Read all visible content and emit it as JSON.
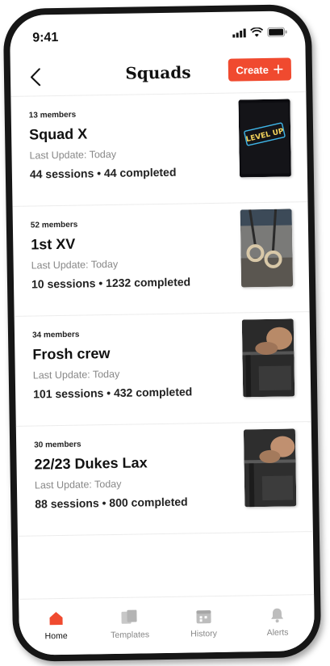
{
  "status_bar": {
    "time": "9:41"
  },
  "header": {
    "title": "Squads",
    "create_label": "Create"
  },
  "squads": [
    {
      "members": "13 members",
      "name": "Squad X",
      "last_update": "Last Update: Today",
      "stats": "44 sessions • 44 completed"
    },
    {
      "members": "52 members",
      "name": "1st XV",
      "last_update": "Last Update: Today",
      "stats": "10 sessions • 1232 completed"
    },
    {
      "members": "34 members",
      "name": "Frosh crew",
      "last_update": "Last Update: Today",
      "stats": "101 sessions • 432 completed"
    },
    {
      "members": "30 members",
      "name": "22/23 Dukes Lax",
      "last_update": "Last Update: Today",
      "stats": "88 sessions • 800 completed"
    }
  ],
  "thumb_sign": "LEVEL UP",
  "tabs": [
    {
      "label": "Home",
      "icon": "home-icon",
      "active": true
    },
    {
      "label": "Templates",
      "icon": "templates-icon",
      "active": false
    },
    {
      "label": "History",
      "icon": "calendar-icon",
      "active": false
    },
    {
      "label": "Alerts",
      "icon": "bell-icon",
      "active": false
    }
  ],
  "colors": {
    "accent": "#f04a2f",
    "muted": "#888888",
    "text": "#111111"
  }
}
